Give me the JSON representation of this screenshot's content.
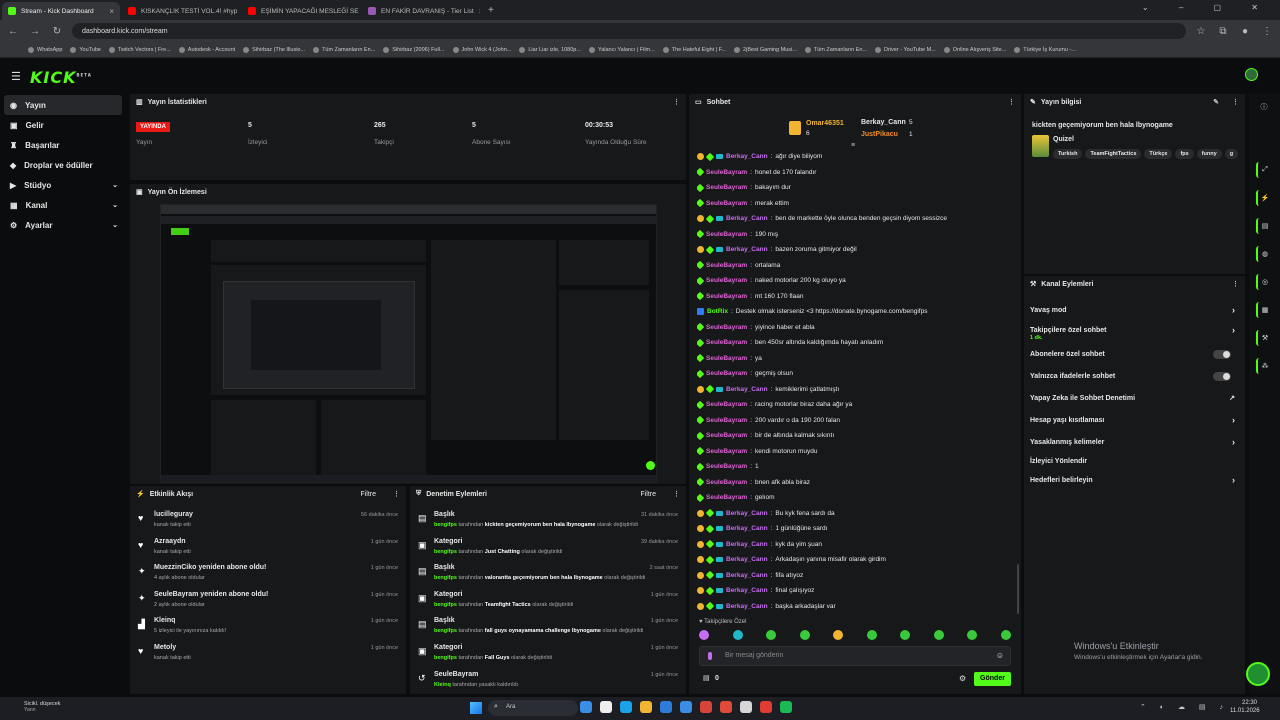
{
  "browser": {
    "tabs": [
      {
        "title": "Stream - Kick Dashboard",
        "color": "#53fc18",
        "active": true
      },
      {
        "title": "KISKANÇLIK TESTİ VOL.4! #hyp",
        "color": "#ff0000",
        "active": false
      },
      {
        "title": "EŞİMİN YAPACAĞI MESLEĞİ SE",
        "color": "#ff0000",
        "active": false
      },
      {
        "title": "EN FAKİR DAVRANIŞ - Tier List",
        "color": "#9b59b6",
        "active": false
      }
    ],
    "url": "dashboard.kick.com/stream",
    "bookmarks": [
      "WhatsApp",
      "YouTube",
      "Twitch Vectors | Fre...",
      "Autodesk - Account",
      "Sihirbaz (The Illusio...",
      "Tüm Zamanların En...",
      "Sihirbaz (2006) Full...",
      "John Wick 4 (John...",
      "Liar Liar izle, 1080p...",
      "Yalancı Yalancı | Film...",
      "The Hateful Eight | F...",
      "2jBest Gaming Musi...",
      "Tüm Zamanların En...",
      "Driver - YouTube M...",
      "Online Alışveriş Site...",
      "Türkiye İş Kurumu -..."
    ]
  },
  "app": {
    "logo": "KICK",
    "logo_sup": "BETA",
    "accent": "#53fc18"
  },
  "sidebar": {
    "items": [
      {
        "label": "Yayın",
        "icon": "broadcast-icon"
      },
      {
        "label": "Gelir",
        "icon": "money-icon"
      },
      {
        "label": "Başarılar",
        "icon": "trophy-icon"
      },
      {
        "label": "Droplar ve ödüller",
        "icon": "gift-icon"
      },
      {
        "label": "Stüdyo",
        "icon": "studio-icon"
      },
      {
        "label": "Kanal",
        "icon": "channel-icon"
      },
      {
        "label": "Ayarlar",
        "icon": "gear-icon"
      }
    ]
  },
  "stats": {
    "title": "Yayın İstatistikleri",
    "live_badge": "YAYINDA",
    "items": [
      {
        "value": "5",
        "label": "İzleyici"
      },
      {
        "value": "265",
        "label": "Takipçi"
      },
      {
        "value": "5",
        "label": "Abone Sayısı"
      },
      {
        "value": "00:30:53",
        "label": "Yayında Olduğu Süre"
      }
    ],
    "first_label": "Yayın"
  },
  "preview": {
    "title": "Yayın Ön İzlemesi"
  },
  "activity": {
    "title": "Etkinlik Akışı",
    "filter": "Filtre",
    "items": [
      {
        "title": "lucilleguray",
        "sub": "kanalı takip etti",
        "time": "56 dakika önce",
        "icon": "heart-icon"
      },
      {
        "title": "Azraaydn",
        "sub": "kanalı takip etti",
        "time": "1 gün önce",
        "icon": "heart-icon"
      },
      {
        "title": "MuezzinCiko yeniden abone oldu!",
        "sub": "4 aylık abone oldular",
        "time": "1 gün önce",
        "icon": "star-icon"
      },
      {
        "title": "SeuleBayram yeniden abone oldu!",
        "sub": "2 aylık abone oldular",
        "time": "1 gün önce",
        "icon": "star-icon"
      },
      {
        "title": "Kleinq",
        "sub": "5 izleyici ile yayınınıza katıldı!",
        "time": "1 gün önce",
        "icon": "raid-icon"
      },
      {
        "title": "Metoly",
        "sub": "kanalı takip etti",
        "time": "1 gün önce",
        "icon": "heart-icon"
      }
    ]
  },
  "moderation": {
    "title": "Denetim Eylemleri",
    "filter": "Filtre",
    "items": [
      {
        "title": "Başlık",
        "actor": "bengifps",
        "text": " tarafından ",
        "bold": "kickten geçemiyorum ben hala lbynogame",
        "tail": " olarak değiştirildi",
        "time": "31 dakika önce"
      },
      {
        "title": "Kategori",
        "actor": "bengifps",
        "text": " tarafından ",
        "bold": "Just Chatting",
        "tail": " olarak değiştirildi",
        "time": "39 dakika önce"
      },
      {
        "title": "Başlık",
        "actor": "bengifps",
        "text": " tarafından ",
        "bold": "valorantta geçemiyorum ben hala lbynogame",
        "tail": " olarak değiştirildi",
        "time": "2 saat önce"
      },
      {
        "title": "Kategori",
        "actor": "bengifps",
        "text": " tarafından ",
        "bold": "Teamfight Tactics",
        "tail": " olarak değiştirildi",
        "time": "1 gün önce"
      },
      {
        "title": "Başlık",
        "actor": "bengifps",
        "text": " tarafından ",
        "bold": "fall guys oynayamama challenge lbynogame",
        "tail": " olarak değiştirildi",
        "time": "1 gün önce"
      },
      {
        "title": "Kategori",
        "actor": "bengifps",
        "text": " tarafından ",
        "bold": "Fall Guys",
        "tail": " olarak değiştirildi",
        "time": "1 gün önce"
      },
      {
        "title": "SeuleBayram",
        "actor": "Kleinq",
        "text": " tarafından yasaklı kaldırıldı",
        "bold": "",
        "tail": "",
        "time": "1 gün önce"
      }
    ]
  },
  "chat": {
    "title": "Sohbet",
    "top_gifters": [
      {
        "name": "Omar46351",
        "count": "6"
      },
      {
        "name": "Berkay_Cann",
        "count": "5"
      },
      {
        "name": "JustPikacu",
        "count": "1"
      }
    ],
    "messages": [
      {
        "user": "Berkay_Cann",
        "text": "ağır diye biliyom",
        "style": "u1",
        "sub": true
      },
      {
        "user": "SeuleBayram",
        "text": "honet de 170 falandır",
        "style": "u2",
        "sub": false
      },
      {
        "user": "SeuleBayram",
        "text": "bakayım dur",
        "style": "u2",
        "sub": false
      },
      {
        "user": "SeuleBayram",
        "text": "merak ettim",
        "style": "u2",
        "sub": false
      },
      {
        "user": "Berkay_Cann",
        "text": "ben de markette öyle olunca benden geçsin diyom sessizce",
        "style": "u1",
        "sub": true
      },
      {
        "user": "SeuleBayram",
        "text": "190 mış",
        "style": "u2",
        "sub": false
      },
      {
        "user": "Berkay_Cann",
        "text": "bazen zoruma gitmiyor değil",
        "style": "u1",
        "sub": true
      },
      {
        "user": "SeuleBayram",
        "text": "ortalama",
        "style": "u2",
        "sub": false
      },
      {
        "user": "SeuleBayram",
        "text": "naked motorlar 200 kg oluyo ya",
        "style": "u2",
        "sub": false
      },
      {
        "user": "SeuleBayram",
        "text": "mt 160 170 flaan",
        "style": "u2",
        "sub": false
      },
      {
        "user": "BotRix",
        "text": "Destek olmak isterseniz <3 https://donate.bynogame.com/bengifps",
        "style": "u3",
        "sub": false,
        "bot": true
      },
      {
        "user": "SeuleBayram",
        "text": "yiyince haber et abla",
        "style": "u2",
        "sub": false
      },
      {
        "user": "SeuleBayram",
        "text": "ben 450sr altında kaldığımda hayatı anladım",
        "style": "u2",
        "sub": false
      },
      {
        "user": "SeuleBayram",
        "text": "ya",
        "style": "u2",
        "sub": false
      },
      {
        "user": "SeuleBayram",
        "text": "geçmiş olsun",
        "style": "u2",
        "sub": false
      },
      {
        "user": "Berkay_Cann",
        "text": "kemiklerimi çatlatmıştı",
        "style": "u1",
        "sub": true
      },
      {
        "user": "SeuleBayram",
        "text": "racing motorlar biraz daha ağır ya",
        "style": "u2",
        "sub": false
      },
      {
        "user": "SeuleBayram",
        "text": "200 vardır o da 190 200 falan",
        "style": "u2",
        "sub": false
      },
      {
        "user": "SeuleBayram",
        "text": "bir de altında kalmak sıkıntı",
        "style": "u2",
        "sub": false
      },
      {
        "user": "SeuleBayram",
        "text": "kendi motorun muydu",
        "style": "u2",
        "sub": false
      },
      {
        "user": "SeuleBayram",
        "text": "1",
        "style": "u2",
        "sub": false
      },
      {
        "user": "SeuleBayram",
        "text": "bnen afk abla biraz",
        "style": "u2",
        "sub": false
      },
      {
        "user": "SeuleBayram",
        "text": "gelıom",
        "style": "u2",
        "sub": false
      },
      {
        "user": "Berkay_Cann",
        "text": "Bu kyk fena sardı da",
        "style": "u1",
        "sub": true
      },
      {
        "user": "Berkay_Cann",
        "text": "1 günlüğüne sardı",
        "style": "u1",
        "sub": true
      },
      {
        "user": "Berkay_Cann",
        "text": "kyk da yim şuan",
        "style": "u1",
        "sub": true
      },
      {
        "user": "Berkay_Cann",
        "text": "Arkadaşın yanına misafir olarak girdim",
        "style": "u1",
        "sub": true
      },
      {
        "user": "Berkay_Cann",
        "text": "fifa atıyoz",
        "style": "u1",
        "sub": true
      },
      {
        "user": "Berkay_Cann",
        "text": "final çalışıyoz",
        "style": "u1",
        "sub": true
      },
      {
        "user": "Berkay_Cann",
        "text": "başka arkadaşlar var",
        "style": "u1",
        "sub": true
      }
    ],
    "follower_only": "Takipçilere Özel",
    "input_placeholder": "Bir mesaj gönderin",
    "count": "0",
    "send": "Gönder"
  },
  "stream_info": {
    "title": "Yayın bilgisi",
    "stream_title": "kickten geçemiyorum ben hala lbynogame",
    "category": "Quizel",
    "tags": [
      "Turkish",
      "TeamFightTactics",
      "Türkçe",
      "fps",
      "funny",
      "g"
    ]
  },
  "channel_actions": {
    "title": "Kanal Eylemleri",
    "items": [
      {
        "label": "Yavaş mod",
        "type": "arrow"
      },
      {
        "label": "Takipçilere özel sohbet",
        "type": "arrow",
        "sub": "1 dk."
      },
      {
        "label": "Abonelere özel sohbet",
        "type": "toggle"
      },
      {
        "label": "Yalnızca ifadelerle sohbet",
        "type": "toggle"
      },
      {
        "label": "Yapay Zeka ile Sohbet Denetimi",
        "type": "external"
      },
      {
        "label": "Hesap yaşı kısıtlaması",
        "type": "arrow"
      },
      {
        "label": "Yasaklanmış kelimeler",
        "type": "arrow"
      },
      {
        "label": "İzleyici Yönlendir",
        "type": "none"
      },
      {
        "label": "Hedefleri belirleyin",
        "type": "arrow"
      }
    ]
  },
  "windows": {
    "activate_title": "Windows'u Etkinleştir",
    "activate_sub": "Windows'u etkinleştirmek için Ayarlar'a gidin.",
    "weather_title": "Sicikl. düşecek",
    "weather_sub": "Yarın",
    "search": "Ara",
    "time": "22:30",
    "date": "11.01.2026"
  }
}
